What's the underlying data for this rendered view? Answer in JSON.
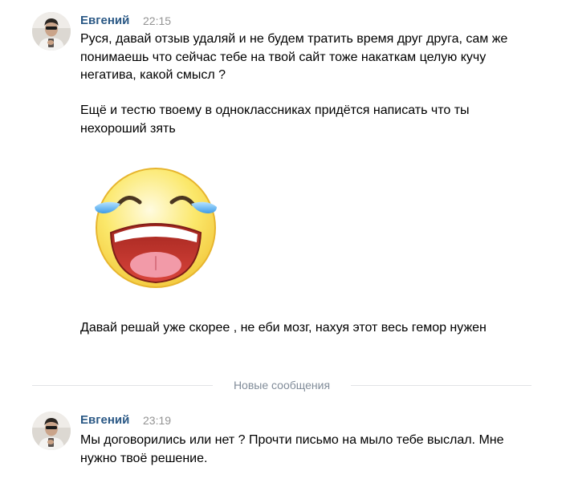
{
  "messages": [
    {
      "author": "Евгений",
      "time": "22:15",
      "texts": [
        "Руся, давай отзыв удаляй и не будем тратить время друг друга, сам же понимаешь что сейчас тебе на твой сайт тоже накаткам целую кучу негатива, какой смысл ?",
        "Ещё и тестю твоему в одноклассниках придётся написать что ты нехороший зять",
        "Давай решай уже скорее , не еби мозг, нахуя этот весь гемор нужен"
      ],
      "sticker": "laughing-tears-smiley"
    },
    {
      "author": "Евгений",
      "time": "23:19",
      "texts": [
        "Мы договорились или нет ? Прочти письмо на мыло тебе выслал. Мне нужно твоё решение."
      ]
    }
  ],
  "divider": {
    "label": "Новые сообщения"
  },
  "colors": {
    "author": "#2a5885",
    "time": "#939393",
    "divider_text": "#818c99",
    "divider_line": "#e1e3e6",
    "text": "#000000"
  }
}
